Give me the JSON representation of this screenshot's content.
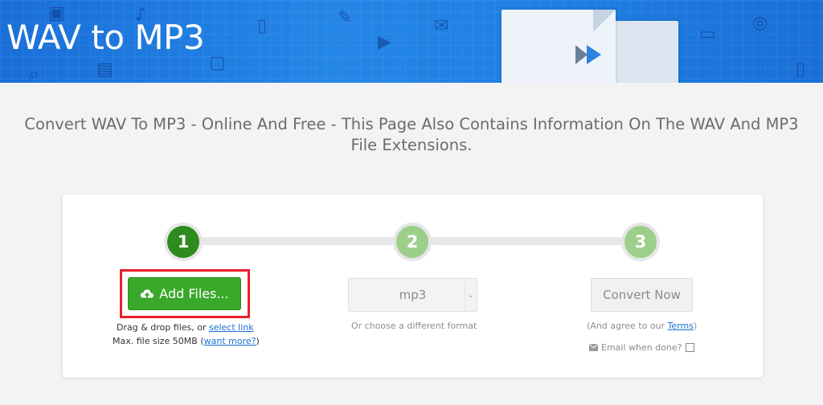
{
  "banner": {
    "title_prefix": "WAV",
    "title_mid": "to",
    "title_suffix": "MP3"
  },
  "headline": "Convert WAV To MP3 - Online And Free - This Page Also Contains Information On The WAV And MP3 File Extensions.",
  "steps": [
    {
      "number": "1"
    },
    {
      "number": "2"
    },
    {
      "number": "3"
    }
  ],
  "upload": {
    "button_label": "Add Files...",
    "drag_text": "Drag & drop files, or ",
    "select_link": "select link",
    "max_size_text": "Max. file size 50MB (",
    "want_more_link": "want more?",
    "max_size_close": ")"
  },
  "format": {
    "selected": "mp3",
    "hint": "Or choose a different format"
  },
  "convert": {
    "button_label": "Convert Now",
    "agree_prefix": "(And agree to our ",
    "terms_link": "Terms",
    "agree_suffix": ")",
    "email_label": "Email when done?"
  },
  "colors": {
    "banner": "#2486e6",
    "primary_green": "#3aa92b",
    "active_step": "#2e8b1e",
    "inactive_step": "#9ccf8a",
    "highlight": "#e8202a",
    "link": "#1a6fd8"
  }
}
